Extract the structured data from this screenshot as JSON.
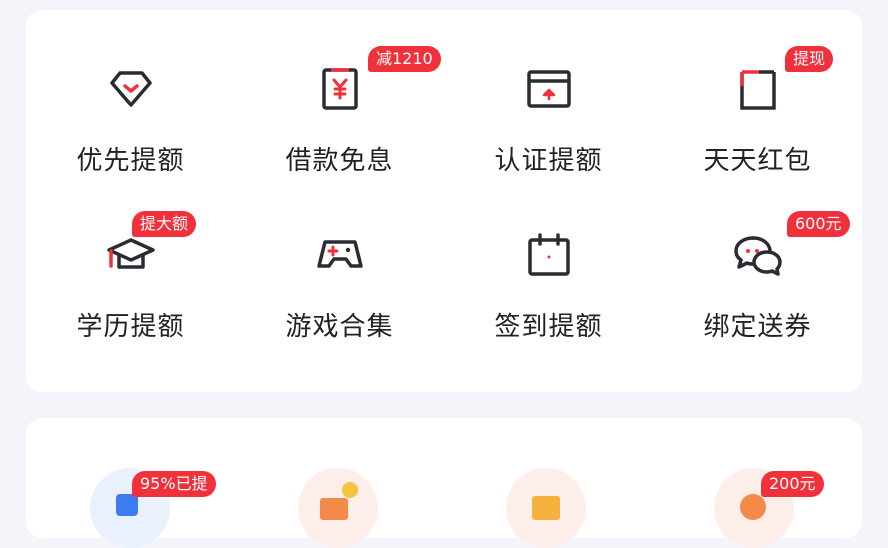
{
  "grid": [
    {
      "label": "优先提额",
      "icon": "diamond-icon",
      "badge": ""
    },
    {
      "label": "借款免息",
      "icon": "yuan-card-icon",
      "badge": "减1210"
    },
    {
      "label": "认证提额",
      "icon": "certificate-icon",
      "badge": ""
    },
    {
      "label": "天天红包",
      "icon": "red-envelope-icon",
      "badge": "提现"
    },
    {
      "label": "学历提额",
      "icon": "graduation-cap-icon",
      "badge": "提大额"
    },
    {
      "label": "游戏合集",
      "icon": "gamepad-icon",
      "badge": ""
    },
    {
      "label": "签到提额",
      "icon": "calendar-icon",
      "badge": ""
    },
    {
      "label": "绑定送券",
      "icon": "chat-bubbles-icon",
      "badge": "600元"
    }
  ],
  "bottom": {
    "badges": [
      "95%已提",
      "200元"
    ]
  },
  "colors": {
    "accent": "#f0303a",
    "icon_dark": "#2b2b33",
    "background": "#f4f5fa"
  }
}
